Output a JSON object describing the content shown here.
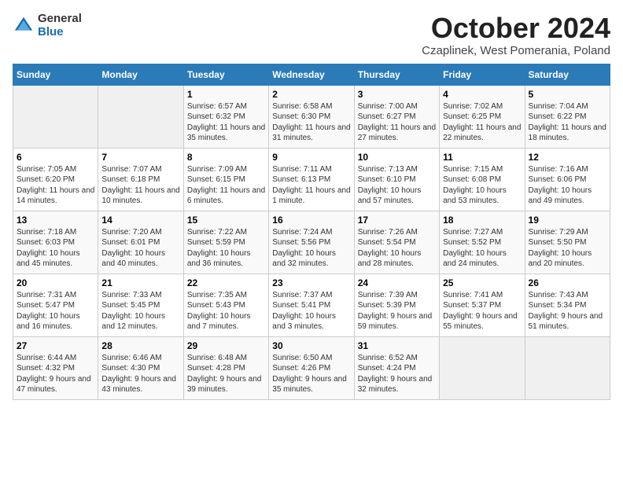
{
  "logo": {
    "general": "General",
    "blue": "Blue"
  },
  "title": "October 2024",
  "location": "Czaplinek, West Pomerania, Poland",
  "days_header": [
    "Sunday",
    "Monday",
    "Tuesday",
    "Wednesday",
    "Thursday",
    "Friday",
    "Saturday"
  ],
  "weeks": [
    [
      {
        "day": "",
        "info": ""
      },
      {
        "day": "",
        "info": ""
      },
      {
        "day": "1",
        "info": "Sunrise: 6:57 AM\nSunset: 6:32 PM\nDaylight: 11 hours and 35 minutes."
      },
      {
        "day": "2",
        "info": "Sunrise: 6:58 AM\nSunset: 6:30 PM\nDaylight: 11 hours and 31 minutes."
      },
      {
        "day": "3",
        "info": "Sunrise: 7:00 AM\nSunset: 6:27 PM\nDaylight: 11 hours and 27 minutes."
      },
      {
        "day": "4",
        "info": "Sunrise: 7:02 AM\nSunset: 6:25 PM\nDaylight: 11 hours and 22 minutes."
      },
      {
        "day": "5",
        "info": "Sunrise: 7:04 AM\nSunset: 6:22 PM\nDaylight: 11 hours and 18 minutes."
      }
    ],
    [
      {
        "day": "6",
        "info": "Sunrise: 7:05 AM\nSunset: 6:20 PM\nDaylight: 11 hours and 14 minutes."
      },
      {
        "day": "7",
        "info": "Sunrise: 7:07 AM\nSunset: 6:18 PM\nDaylight: 11 hours and 10 minutes."
      },
      {
        "day": "8",
        "info": "Sunrise: 7:09 AM\nSunset: 6:15 PM\nDaylight: 11 hours and 6 minutes."
      },
      {
        "day": "9",
        "info": "Sunrise: 7:11 AM\nSunset: 6:13 PM\nDaylight: 11 hours and 1 minute."
      },
      {
        "day": "10",
        "info": "Sunrise: 7:13 AM\nSunset: 6:10 PM\nDaylight: 10 hours and 57 minutes."
      },
      {
        "day": "11",
        "info": "Sunrise: 7:15 AM\nSunset: 6:08 PM\nDaylight: 10 hours and 53 minutes."
      },
      {
        "day": "12",
        "info": "Sunrise: 7:16 AM\nSunset: 6:06 PM\nDaylight: 10 hours and 49 minutes."
      }
    ],
    [
      {
        "day": "13",
        "info": "Sunrise: 7:18 AM\nSunset: 6:03 PM\nDaylight: 10 hours and 45 minutes."
      },
      {
        "day": "14",
        "info": "Sunrise: 7:20 AM\nSunset: 6:01 PM\nDaylight: 10 hours and 40 minutes."
      },
      {
        "day": "15",
        "info": "Sunrise: 7:22 AM\nSunset: 5:59 PM\nDaylight: 10 hours and 36 minutes."
      },
      {
        "day": "16",
        "info": "Sunrise: 7:24 AM\nSunset: 5:56 PM\nDaylight: 10 hours and 32 minutes."
      },
      {
        "day": "17",
        "info": "Sunrise: 7:26 AM\nSunset: 5:54 PM\nDaylight: 10 hours and 28 minutes."
      },
      {
        "day": "18",
        "info": "Sunrise: 7:27 AM\nSunset: 5:52 PM\nDaylight: 10 hours and 24 minutes."
      },
      {
        "day": "19",
        "info": "Sunrise: 7:29 AM\nSunset: 5:50 PM\nDaylight: 10 hours and 20 minutes."
      }
    ],
    [
      {
        "day": "20",
        "info": "Sunrise: 7:31 AM\nSunset: 5:47 PM\nDaylight: 10 hours and 16 minutes."
      },
      {
        "day": "21",
        "info": "Sunrise: 7:33 AM\nSunset: 5:45 PM\nDaylight: 10 hours and 12 minutes."
      },
      {
        "day": "22",
        "info": "Sunrise: 7:35 AM\nSunset: 5:43 PM\nDaylight: 10 hours and 7 minutes."
      },
      {
        "day": "23",
        "info": "Sunrise: 7:37 AM\nSunset: 5:41 PM\nDaylight: 10 hours and 3 minutes."
      },
      {
        "day": "24",
        "info": "Sunrise: 7:39 AM\nSunset: 5:39 PM\nDaylight: 9 hours and 59 minutes."
      },
      {
        "day": "25",
        "info": "Sunrise: 7:41 AM\nSunset: 5:37 PM\nDaylight: 9 hours and 55 minutes."
      },
      {
        "day": "26",
        "info": "Sunrise: 7:43 AM\nSunset: 5:34 PM\nDaylight: 9 hours and 51 minutes."
      }
    ],
    [
      {
        "day": "27",
        "info": "Sunrise: 6:44 AM\nSunset: 4:32 PM\nDaylight: 9 hours and 47 minutes."
      },
      {
        "day": "28",
        "info": "Sunrise: 6:46 AM\nSunset: 4:30 PM\nDaylight: 9 hours and 43 minutes."
      },
      {
        "day": "29",
        "info": "Sunrise: 6:48 AM\nSunset: 4:28 PM\nDaylight: 9 hours and 39 minutes."
      },
      {
        "day": "30",
        "info": "Sunrise: 6:50 AM\nSunset: 4:26 PM\nDaylight: 9 hours and 35 minutes."
      },
      {
        "day": "31",
        "info": "Sunrise: 6:52 AM\nSunset: 4:24 PM\nDaylight: 9 hours and 32 minutes."
      },
      {
        "day": "",
        "info": ""
      },
      {
        "day": "",
        "info": ""
      }
    ]
  ]
}
